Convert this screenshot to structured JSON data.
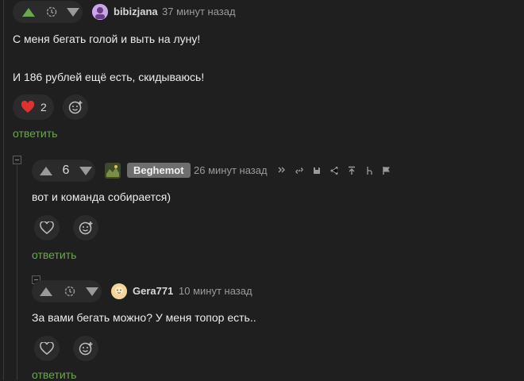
{
  "comments": [
    {
      "username": "bibizjana",
      "time": "37 минут назад",
      "text_lines": [
        "С меня бегать голой и выть на луну!",
        "И 186 рублей ещё есть, скидываюсь!"
      ],
      "likes": "2",
      "reply_label": "ответить"
    },
    {
      "username": "Beghemot",
      "score": "6",
      "time": "26 минут назад",
      "text_lines": [
        "вот и команда собирается)"
      ],
      "reply_label": "ответить"
    },
    {
      "username": "Gera771",
      "time": "10 минут назад",
      "text_lines": [
        "За вами бегать можно? У меня топор есть.."
      ],
      "reply_label": "ответить"
    }
  ],
  "colors": {
    "accent_green": "#6aa84f",
    "like_red": "#e03131",
    "bg": "#1f1f1f",
    "pill": "#2b2b2b"
  }
}
